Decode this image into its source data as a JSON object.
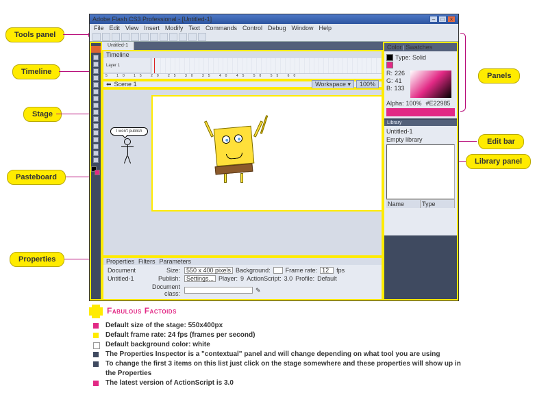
{
  "callouts": {
    "tools": "Tools panel",
    "timeline": "Timeline",
    "stage": "Stage",
    "pasteboard": "Pasteboard",
    "properties": "Properties",
    "panels": "Panels",
    "editbar": "Edit bar",
    "library": "Library panel"
  },
  "app": {
    "title": "Adobe Flash CS3 Professional - [Untitled-1]",
    "menu": [
      "File",
      "Edit",
      "View",
      "Insert",
      "Modify",
      "Text",
      "Commands",
      "Control",
      "Debug",
      "Window",
      "Help"
    ],
    "doc_tab": "Untitled-1",
    "timeline_tab": "Timeline",
    "layer": "Layer 1",
    "ruler": "5   10   15   20   25   30   35   40   45   50   55   60",
    "editbar": {
      "scene": "Scene 1",
      "workspace": "Workspace ▾",
      "zoom": "100%"
    },
    "bubble": "I won't publish",
    "props": {
      "tab1": "Properties",
      "tab2": "Filters",
      "tab3": "Parameters",
      "doc": "Document",
      "docname": "Untitled-1",
      "size_l": "Size:",
      "size_v": "550 x 400 pixels",
      "bg_l": "Background:",
      "fr_l": "Frame rate:",
      "fr_v": "12",
      "fps": "fps",
      "pub_l": "Publish:",
      "pub_v": "Settings...",
      "player_l": "Player:",
      "player_v": "9",
      "as_l": "ActionScript:",
      "as_v": "3.0",
      "prof_l": "Profile:",
      "prof_v": "Default",
      "dc_l": "Document class:"
    },
    "panels": {
      "color": "Color",
      "swatches": "Swatches",
      "type": "Type:",
      "solid": "Solid",
      "r": "R:",
      "rv": "226",
      "g": "G:",
      "gv": "41",
      "b": "B:",
      "bv": "133",
      "alpha": "Alpha:",
      "av": "100%",
      "hex": "#E22985",
      "library": "Library",
      "libsel": "Untitled-1",
      "empty": "Empty library",
      "name": "Name",
      "typecol": "Type"
    }
  },
  "factoids": {
    "title": "Fabulous Factoids",
    "items": [
      "Default size of the stage: 550x400px",
      "Default frame rate: 24 fps (frames per second)",
      "Default background color: white",
      "The Properties Inspector is a \"contextual\" panel and will change depending on what tool you are using",
      "To change the first 3 items on this list just click on the stage somewhere and these properties will show up in the Properties",
      "The latest version of ActionScript is 3.0"
    ]
  }
}
